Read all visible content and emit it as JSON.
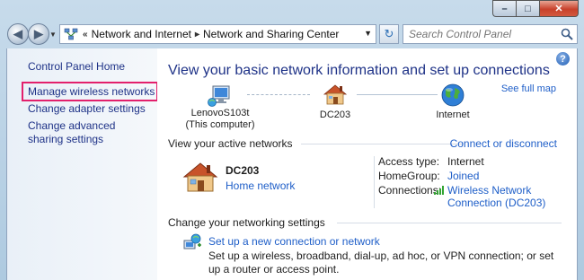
{
  "window": {
    "caption_min": "–",
    "caption_max": "□",
    "caption_close": "✕"
  },
  "navbar": {
    "back_glyph": "◀",
    "forward_glyph": "▶",
    "breadcrumb_prefix": "«",
    "breadcrumbs": [
      "Network and Internet",
      "Network and Sharing Center"
    ],
    "crumb_separator": "▸",
    "dropdown_glyph": "▼",
    "refresh_glyph": "↻",
    "search_placeholder": "Search Control Panel"
  },
  "leftpane": {
    "items": [
      "Control Panel Home",
      "Manage wireless networks",
      "Change adapter settings",
      "Change advanced sharing settings"
    ],
    "highlight_color": "#e3206c"
  },
  "main": {
    "help_glyph": "?",
    "title": "View your basic network information and set up connections",
    "see_full_map": "See full map",
    "network_map": {
      "computer_name": "LenovoS103t",
      "computer_sub": "(This computer)",
      "network_name": "DC203",
      "internet_label": "Internet"
    },
    "active_networks": {
      "heading": "View your active networks",
      "action": "Connect or disconnect",
      "network_name": "DC203",
      "network_type": "Home network",
      "access_type_label": "Access type:",
      "access_type_value": "Internet",
      "homegroup_label": "HomeGroup:",
      "homegroup_value": "Joined",
      "connections_label": "Connections:",
      "connections_value_line1": "Wireless Network",
      "connections_value_line2": "Connection (DC203)"
    },
    "settings": {
      "heading": "Change your networking settings",
      "task_link": "Set up a new connection or network",
      "task_desc": "Set up a wireless, broadband, dial-up, ad hoc, or VPN connection; or set up a router or access point."
    }
  },
  "colors": {
    "link": "#1e5ec8",
    "title": "#1e3287",
    "left_pane_link": "#1e3287"
  }
}
